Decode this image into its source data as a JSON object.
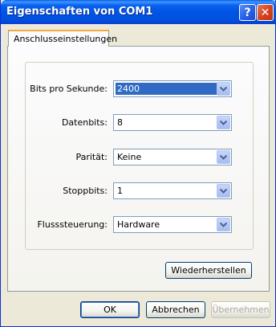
{
  "window": {
    "title": "Eigenschaften von COM1",
    "help_glyph": "?",
    "close_glyph": "✕"
  },
  "tabs": [
    {
      "label": "Anschlusseinstellungen",
      "active": true
    }
  ],
  "settings": {
    "bits_per_second": {
      "label": "Bits pro Sekunde:",
      "value": "2400"
    },
    "data_bits": {
      "label": "Datenbits:",
      "value": "8"
    },
    "parity": {
      "label": "Parität:",
      "value": "Keine"
    },
    "stop_bits": {
      "label": "Stoppbits:",
      "value": "1"
    },
    "flow_control": {
      "label": "Flusssteuerung:",
      "value": "Hardware"
    }
  },
  "buttons": {
    "restore": "Wiederherstellen",
    "ok": "OK",
    "cancel": "Abbrechen",
    "apply": "Übernehmen"
  },
  "icons": {
    "help": "help-icon",
    "close": "close-icon",
    "dropdown": "chevron-down-icon"
  },
  "colors": {
    "titlebar": "#0054e3",
    "selection": "#316ac5",
    "tab_highlight": "#f4a93a",
    "close_button": "#d5451e"
  }
}
